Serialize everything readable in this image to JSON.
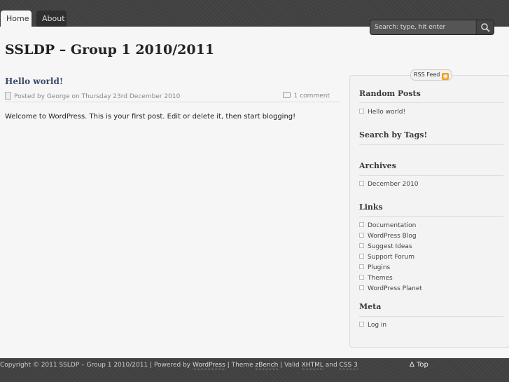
{
  "nav": {
    "tabs": [
      {
        "label": "Home",
        "active": true
      },
      {
        "label": "About",
        "active": false
      }
    ]
  },
  "search": {
    "placeholder": "Search: type, hit enter"
  },
  "header": {
    "title": "SSLDP – Group 1 2010/2011"
  },
  "post": {
    "title": "Hello world!",
    "meta": "Posted by George on Thursday 23rd December 2010",
    "comments": "1 comment",
    "body": "Welcome to WordPress. This is your first post. Edit or delete it, then start blogging!"
  },
  "sidebar": {
    "rss": "RSS Feed",
    "random_posts": {
      "title": "Random Posts",
      "items": [
        "Hello world!"
      ]
    },
    "tags": {
      "title": "Search by Tags!"
    },
    "archives": {
      "title": "Archives",
      "items": [
        "December 2010"
      ]
    },
    "links": {
      "title": "Links",
      "items": [
        "Documentation",
        "WordPress Blog",
        "Suggest Ideas",
        "Support Forum",
        "Plugins",
        "Themes",
        "WordPress Planet"
      ]
    },
    "meta": {
      "title": "Meta",
      "items": [
        "Log in"
      ]
    }
  },
  "footer": {
    "copyright": "Copyright © 2011 SSLDP – Group 1 2010/2011",
    "powered_prefix": "| Powered by",
    "wordpress": "WordPress",
    "theme_prefix": "| Theme",
    "theme": "zBench",
    "valid_prefix": "| Valid",
    "xhtml": "XHTML",
    "and": "and",
    "css": "CSS 3",
    "top": "Δ Top"
  },
  "colors": {
    "bar": "#3f3f3f",
    "post_title": "#3a4a6a",
    "rss_orange": "#f0a020"
  }
}
